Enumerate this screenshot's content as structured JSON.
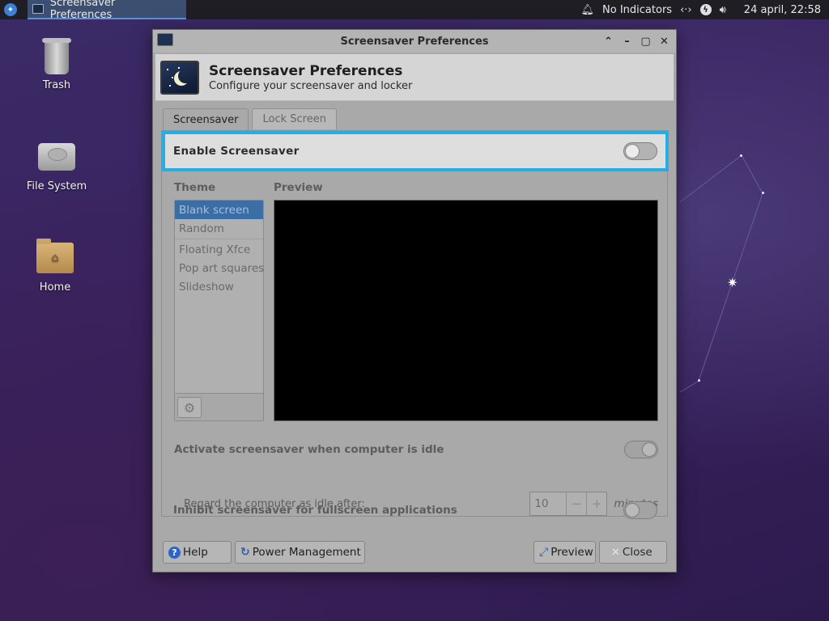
{
  "panel": {
    "menu_icon": "xfce-mouse-icon",
    "task_title": "Screensaver Preferences",
    "indicator_text": "No Indicators",
    "clock": "24 april, 22:58"
  },
  "desktop": {
    "icons": [
      {
        "label": "Trash"
      },
      {
        "label": "File System"
      },
      {
        "label": "Home"
      }
    ]
  },
  "window": {
    "title": "Screensaver Preferences",
    "header_title": "Screensaver Preferences",
    "header_subtitle": "Configure your screensaver and locker",
    "tabs": [
      {
        "label": "Screensaver",
        "active": true
      },
      {
        "label": "Lock Screen",
        "active": false
      }
    ],
    "enable_label": "Enable Screensaver",
    "enable_on": false,
    "theme_heading": "Theme",
    "preview_heading": "Preview",
    "themes": [
      "Blank screen",
      "Random",
      "Floating Xfce",
      "Pop art squares",
      "Slideshow"
    ],
    "selected_theme": "Blank screen",
    "activate_label": "Activate screensaver when computer is idle",
    "activate_on": true,
    "idle_label": "Regard the computer as idle after:",
    "idle_value": "10",
    "spin_minus": "−",
    "spin_plus": "+",
    "idle_unit": "minutes",
    "inhibit_label": "Inhibit screensaver for fullscreen applications",
    "inhibit_on": false,
    "buttons": {
      "help": "Help",
      "power": "Power Management",
      "preview": "Preview",
      "close": "Close"
    }
  },
  "colors": {
    "accent_focus": "#23aee5",
    "selection": "#3a6ea5"
  }
}
